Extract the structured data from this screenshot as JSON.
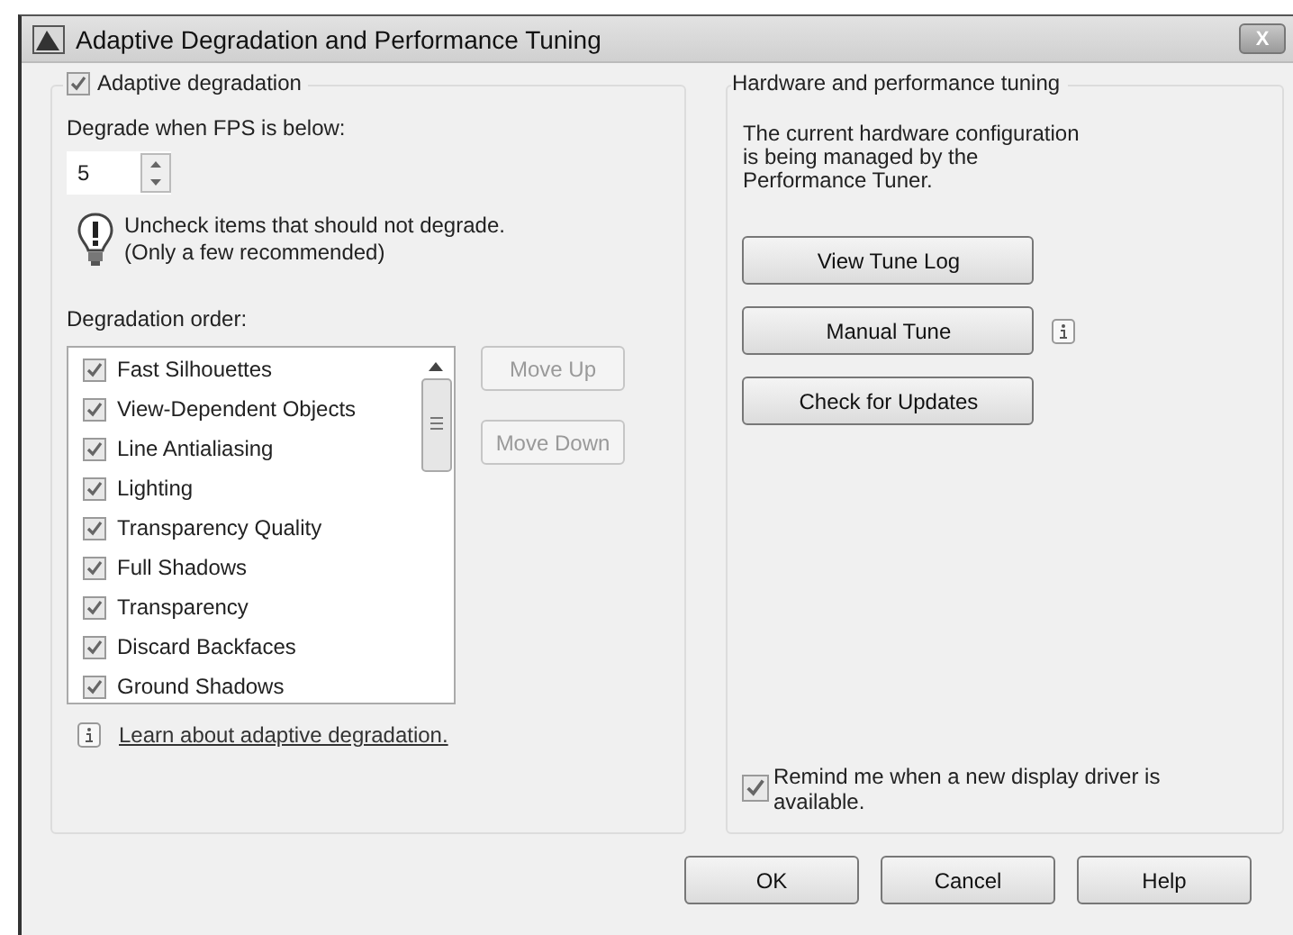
{
  "window": {
    "title": "Adaptive Degradation and Performance Tuning",
    "close": "X"
  },
  "left": {
    "group": {
      "label": "Adaptive degradation",
      "checked": true
    },
    "fps_label": "Degrade when FPS is below:",
    "fps": {
      "value": "5"
    },
    "hint": [
      "Uncheck items that should not degrade.",
      "(Only a few recommended)"
    ],
    "order_label": "Degradation order:",
    "items": [
      {
        "label": "Fast Silhouettes",
        "checked": true
      },
      {
        "label": "View-Dependent Objects",
        "checked": true
      },
      {
        "label": "Line Antialiasing",
        "checked": true
      },
      {
        "label": "Lighting",
        "checked": true
      },
      {
        "label": "Transparency Quality",
        "checked": true
      },
      {
        "label": "Full Shadows",
        "checked": true
      },
      {
        "label": "Transparency",
        "checked": true
      },
      {
        "label": "Discard Backfaces",
        "checked": true
      },
      {
        "label": "Ground Shadows",
        "checked": true
      }
    ],
    "move_buttons": [
      {
        "label": "Move Up",
        "disabled": true
      },
      {
        "label": "Move Down",
        "disabled": true
      }
    ],
    "link": "Learn about adaptive degradation."
  },
  "right": {
    "group_label": "Hardware and performance tuning",
    "text": [
      "The current hardware configuration",
      "is being managed by the",
      "Performance Tuner."
    ],
    "buttons": [
      {
        "label": "View Tune Log",
        "info": false
      },
      {
        "label": "Manual Tune",
        "info": true
      },
      {
        "label": "Check for Updates",
        "info": false
      }
    ],
    "remind": {
      "label": "Remind me when a new display driver is available.",
      "checked": true
    }
  },
  "buttons": [
    "OK",
    "Cancel",
    "Help"
  ]
}
